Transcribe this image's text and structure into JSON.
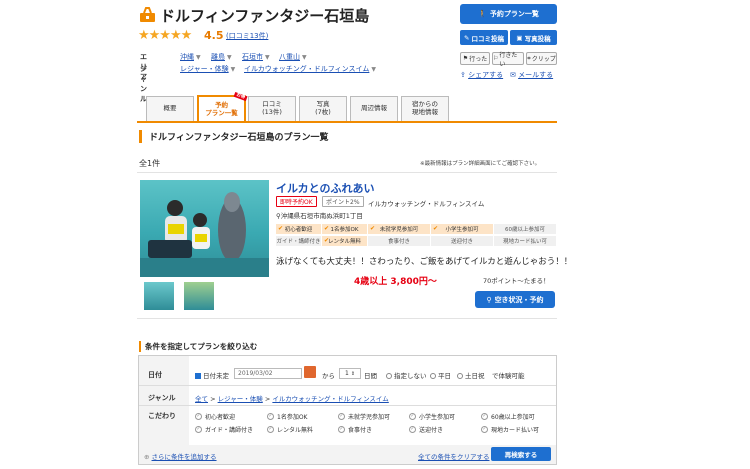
{
  "header": {
    "title": "ドルフィンファンタジー石垣島",
    "stars": "★★★★★",
    "rating": "4.5",
    "review_link": "(口コミ13件)"
  },
  "meta": {
    "area_label": "エリア",
    "areas": [
      "沖縄",
      "離島",
      "石垣市",
      "八重山"
    ],
    "genre_label": "ジャンル",
    "genres": [
      "レジャー・体験",
      "イルカウォッチング・ドルフィンスイム"
    ]
  },
  "actions": {
    "plan_list": "予約プラン一覧",
    "post_review": "口コミ投稿",
    "post_photo": "写真投稿",
    "went": "行った",
    "want_to_go": "行きたい",
    "clip": "クリップ",
    "share": "シェアする",
    "mail": "メールする"
  },
  "tabs": [
    {
      "label": "概要",
      "sub": ""
    },
    {
      "label": "予約",
      "sub": "プラン一覧",
      "badge": "お得",
      "active": true
    },
    {
      "label": "口コミ",
      "sub": "(13件)"
    },
    {
      "label": "写真",
      "sub": "(7枚)"
    },
    {
      "label": "周辺情報",
      "sub": ""
    },
    {
      "label": "宿からの",
      "sub": "現地情報"
    }
  ],
  "section_title": "ドルフィンファンタジー石垣島のプラン一覧",
  "count": "全1件",
  "note": "※最新情報はプラン詳細画面にてご確認下さい。",
  "plan": {
    "name": "イルカとのふれあい",
    "instant": "即時予約OK",
    "point": "ポイント2%",
    "category": "イルカウォッチング・ドルフィンスイム",
    "address": "沖縄県石垣市南ぬ浜町1丁目",
    "features_on": [
      "初心者歓迎",
      "1名参加OK",
      "未就学児参加可",
      "小学生参加可"
    ],
    "features_off_row1": [
      "60歳以上参加可"
    ],
    "features_row2_off": [
      "ガイド・講師付き"
    ],
    "features_row2_on": [
      "レンタル無料"
    ],
    "features_row2_rest": [
      "食事付き",
      "送迎付き",
      "現地カード払い可"
    ],
    "description": "泳げなくても大丈夫！！さわったり、ご飯をあげてイルカと遊んじゃおう！！",
    "price": "4歳以上 3,800円〜",
    "points": "70ポイント〜たまる！",
    "availability_button": "空き状況・予約"
  },
  "filter": {
    "title": "条件を指定してプランを絞り込む",
    "date_label": "日付",
    "date_undecided": "日付未定",
    "date_value": "2019/03/02",
    "from": "から",
    "days_value": "1",
    "days_unit": "日間",
    "options": [
      "指定しない",
      "平日",
      "土日祝"
    ],
    "bookable": "で体験可能",
    "genre_label": "ジャンル",
    "genre_path": [
      "全て",
      "レジャー・体験",
      "イルカウォッチング・ドルフィンスイム"
    ],
    "kodawari_label": "こだわり",
    "kodawari_row1": [
      "初心者歓迎",
      "1名参加OK",
      "未就学児参加可",
      "小学生参加可",
      "60歳以上参加可"
    ],
    "kodawari_row2": [
      "ガイド・講師付き",
      "レンタル無料",
      "食事付き",
      "送迎付き",
      "現地カード払い可"
    ],
    "more_conditions": "さらに条件を追加する",
    "clear_all": "全ての条件をクリアする",
    "research": "再検索する"
  },
  "colors": {
    "accent": "#f08a00",
    "primary": "#1e6fd0",
    "price": "#e60012",
    "star": "#f5a623"
  }
}
